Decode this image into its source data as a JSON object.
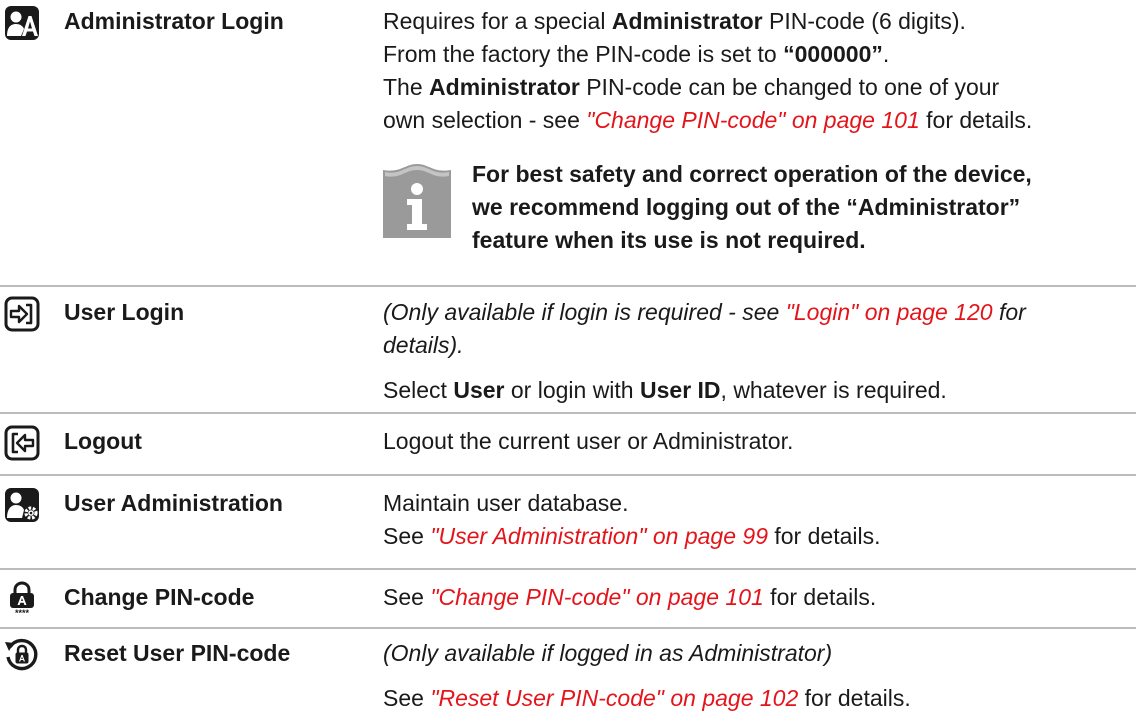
{
  "rows": {
    "admin_login": {
      "icon": "administrator-icon",
      "label": "Administrator Login",
      "l1": {
        "a": "Requires for a special ",
        "b": "Administrator",
        "c": " PIN-code (6 digits)."
      },
      "l2": {
        "a": "From the factory the PIN-code is set to ",
        "b": "“000000”",
        "c": "."
      },
      "l3": {
        "a": "The ",
        "b": "Administrator",
        "c": " PIN-code can be changed to one of your"
      },
      "l4": {
        "a": "own selection - see ",
        "link": "\"Change PIN-code\" on page 101",
        "c": " for details."
      },
      "note": {
        "icon": "info-icon",
        "lines": [
          "For best safety and correct operation of the device,",
          "we recommend logging out of the “Administrator”",
          "feature when its use is not required."
        ]
      }
    },
    "user_login": {
      "icon": "login-icon",
      "label": "User Login",
      "p1": {
        "a": "(Only available if login is required - see ",
        "link": "\"Login\" on page 120",
        "c": " for"
      },
      "p1b": "details).",
      "p2": {
        "a": "Select ",
        "b": "User",
        "c": " or login with ",
        "d": "User ID",
        "e": ", whatever is required."
      }
    },
    "logout": {
      "icon": "logout-icon",
      "label": "Logout",
      "text": "Logout the current user or Administrator."
    },
    "user_admin": {
      "icon": "user-settings-icon",
      "label": "User Administration",
      "l1": "Maintain user database.",
      "l2": {
        "a": "See ",
        "link": "\"User Administration\" on page 99",
        "c": " for details."
      }
    },
    "change_pin": {
      "icon": "pin-lock-icon",
      "label": "Change PIN-code",
      "l1": {
        "a": "See ",
        "link": "\"Change PIN-code\" on page 101",
        "c": " for details."
      }
    },
    "reset_pin": {
      "icon": "reset-lock-icon",
      "label": "Reset User PIN-code",
      "p1": "(Only available if logged in as Administrator)",
      "p2": {
        "a": "See ",
        "link": "\"Reset User PIN-code\" on page 102",
        "c": " for details."
      }
    }
  },
  "colors": {
    "link": "#e4141b",
    "icon": "#1a1a1a",
    "divider": "#bcbcbc",
    "note_icon": "#9a9a9a"
  }
}
